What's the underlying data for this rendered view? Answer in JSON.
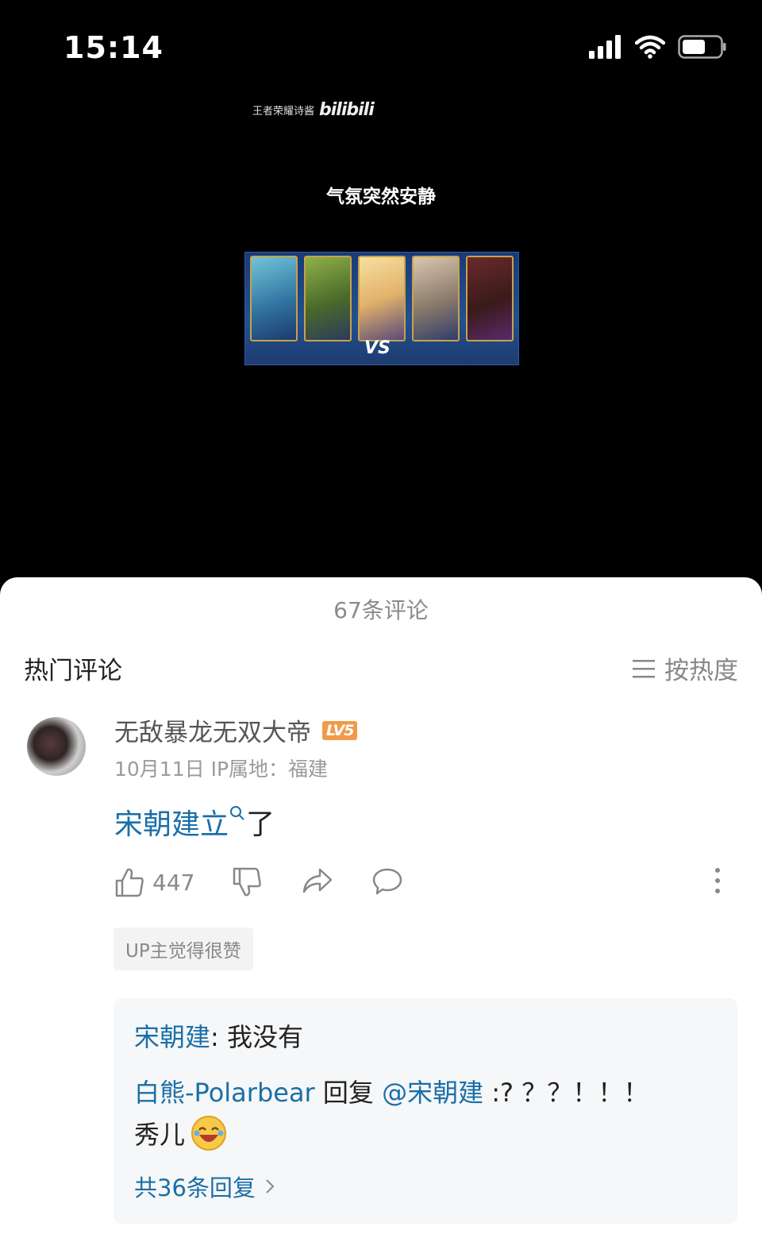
{
  "status_bar": {
    "time": "15:14"
  },
  "video": {
    "watermark_text": "王者荣耀诗酱",
    "watermark_brand": "bilibili",
    "caption": "气氛突然安静",
    "vs_text": "VS"
  },
  "comments_sheet": {
    "count_label": "67条评论",
    "section_title": "热门评论",
    "sort_label": "按热度",
    "comment": {
      "username": "无敌暴龙无双大帝",
      "level_badge": "LV5",
      "meta": "10月11日  IP属地：福建",
      "link_text": "宋朝建立",
      "text_suffix": "了",
      "likes": "447",
      "up_badge": "UP主觉得很赞",
      "replies": {
        "line1_user": "宋朝建",
        "line1_text": ": 我没有",
        "line2_user": "白熊-Polarbear",
        "line2_mid": " 回复 ",
        "line2_mention": "@宋朝建",
        "line2_text": " :? ？？！！！",
        "line3_text": "秀儿",
        "more_label": "共36条回复"
      }
    }
  },
  "colors": {
    "link": "#1a6fa8",
    "level_badge": "#f29a49"
  }
}
